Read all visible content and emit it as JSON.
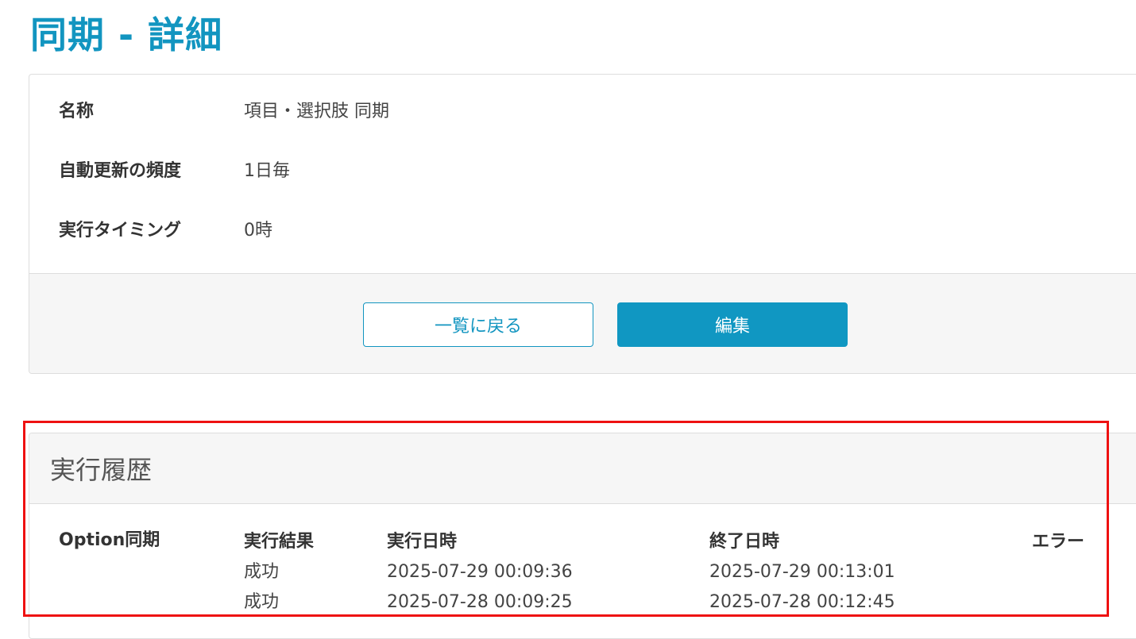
{
  "page": {
    "title": "同期 - 詳細"
  },
  "details": {
    "rows": [
      {
        "label": "名称",
        "value": "項目・選択肢 同期"
      },
      {
        "label": "自動更新の頻度",
        "value": "1日毎"
      },
      {
        "label": "実行タイミング",
        "value": "0時"
      }
    ],
    "back_button_label": "一覧に戻る",
    "edit_button_label": "編集"
  },
  "history": {
    "title": "実行履歴",
    "section_label": "Option同期",
    "columns": [
      "実行結果",
      "実行日時",
      "終了日時",
      "エラー"
    ],
    "rows": [
      {
        "result": "成功",
        "started": "2025-07-29 00:09:36",
        "finished": "2025-07-29 00:13:01",
        "error": ""
      },
      {
        "result": "成功",
        "started": "2025-07-28 00:09:25",
        "finished": "2025-07-28 00:12:45",
        "error": ""
      }
    ]
  },
  "colors": {
    "accent": "#1295c0",
    "highlight": "#ee1111"
  }
}
